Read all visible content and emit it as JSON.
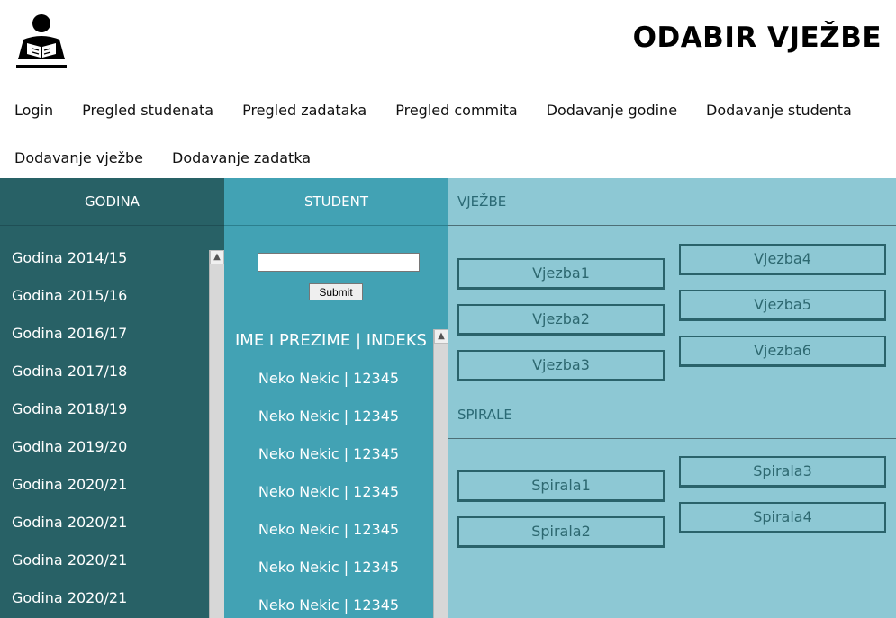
{
  "header": {
    "logo_icon": "reader-icon",
    "title": "ODABIR VJEŽBE"
  },
  "nav": {
    "items": [
      {
        "label": "Login"
      },
      {
        "label": "Pregled studenata"
      },
      {
        "label": "Pregled zadataka"
      },
      {
        "label": "Pregled commita"
      },
      {
        "label": "Dodavanje godine"
      },
      {
        "label": "Dodavanje studenta"
      },
      {
        "label": "Dodavanje vježbe"
      },
      {
        "label": "Dodavanje zadatka"
      }
    ]
  },
  "godina": {
    "heading": "GODINA",
    "years": [
      "Godina 2014/15",
      "Godina 2015/16",
      "Godina 2016/17",
      "Godina 2017/18",
      "Godina 2018/19",
      "Godina 2019/20",
      "Godina 2020/21",
      "Godina 2020/21",
      "Godina 2020/21",
      "Godina 2020/21"
    ]
  },
  "student": {
    "heading": "STUDENT",
    "search_value": "",
    "submit_label": "Submit",
    "list_header": "IME I PREZIME  |  INDEKS",
    "students": [
      "Neko Nekic | 12345",
      "Neko Nekic | 12345",
      "Neko Nekic | 12345",
      "Neko Nekic | 12345",
      "Neko Nekic | 12345",
      "Neko Nekic | 12345",
      "Neko Nekic | 12345"
    ]
  },
  "vjezbe": {
    "heading": "VJEŽBE",
    "left": [
      "Vjezba1",
      "Vjezba2",
      "Vjezba3"
    ],
    "right": [
      "Vjezba4",
      "Vjezba5",
      "Vjezba6"
    ]
  },
  "spirale": {
    "heading": "SPIRALE",
    "left": [
      "Spirala1",
      "Spirala2"
    ],
    "right": [
      "Spirala3",
      "Spirala4"
    ]
  },
  "colors": {
    "godina_bg": "#286166",
    "student_bg": "#42a2b4",
    "vjezbe_bg": "#8dc8d4",
    "button_border": "#2a636b"
  }
}
